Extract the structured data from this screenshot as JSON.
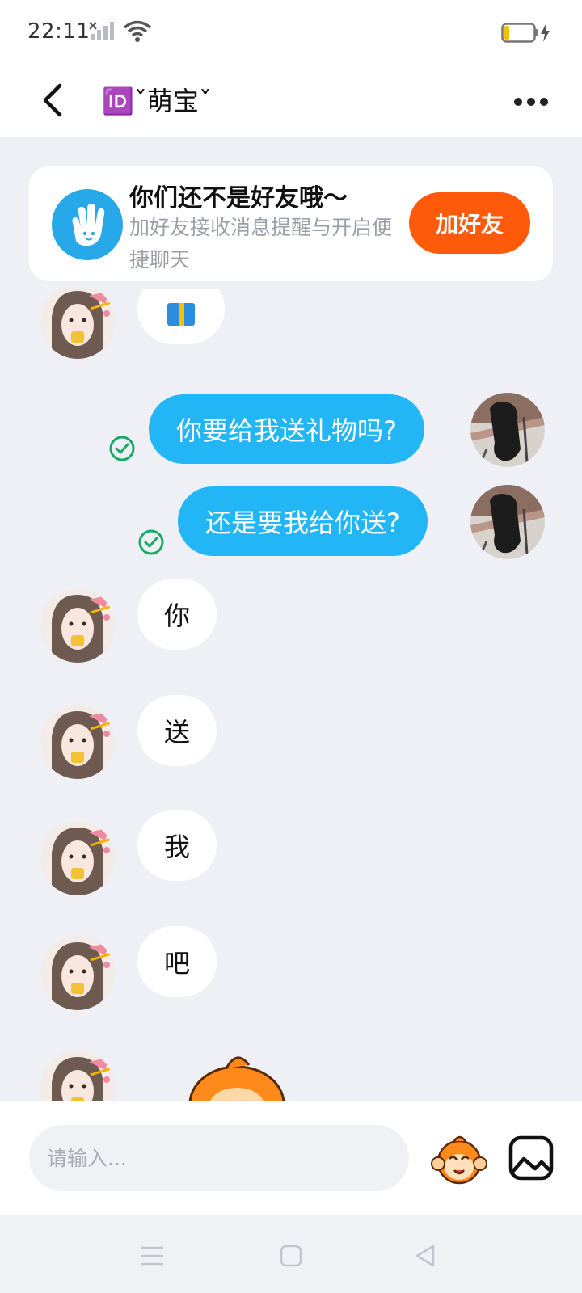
{
  "status_bar": {
    "time": "22:11"
  },
  "header": {
    "title": "🆔ˇ萌宝ˇ"
  },
  "friend_card": {
    "title": "你们还不是好友哦～",
    "subtitle": "加好友接收消息提醒与开启便捷聊天",
    "add_button": "加好友"
  },
  "messages": [
    {
      "side": "in",
      "type": "gift",
      "icon": "gift-icon"
    },
    {
      "side": "out",
      "text": "你要给我送礼物吗?",
      "status": "read"
    },
    {
      "side": "out",
      "text": "还是要我给你送?",
      "status": "read"
    },
    {
      "side": "in",
      "text": "你"
    },
    {
      "side": "in",
      "text": "送"
    },
    {
      "side": "in",
      "text": "我"
    },
    {
      "side": "in",
      "text": "吧"
    },
    {
      "side": "in",
      "type": "sticker",
      "icon": "monkey-sticker-icon"
    }
  ],
  "input": {
    "placeholder": "请输入..."
  },
  "colors": {
    "accent_blue": "#23b6f7",
    "add_button": "#ff5a0a",
    "read_check": "#19a866",
    "background": "#eef0f5"
  }
}
